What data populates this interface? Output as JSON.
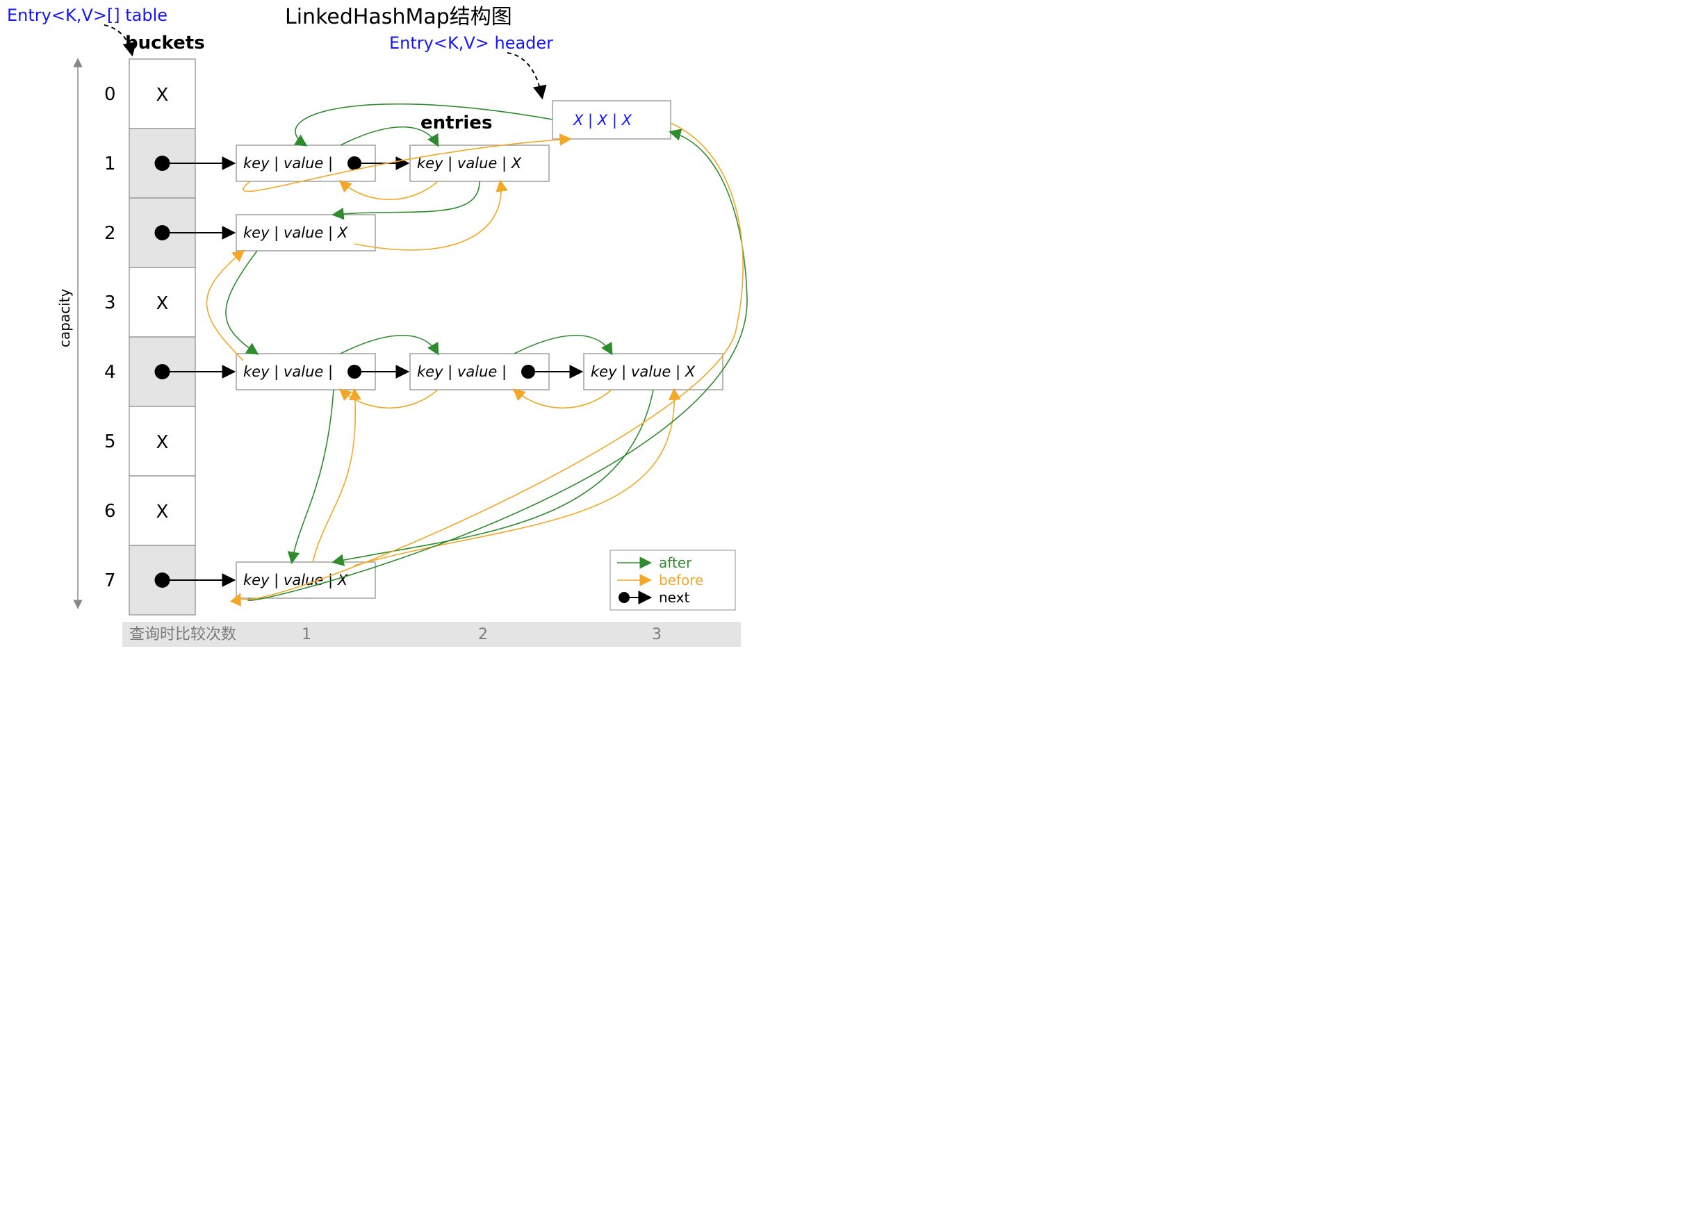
{
  "title": "LinkedHashMap结构图",
  "label_table": "Entry<K,V>[] table",
  "label_header": "Entry<K,V> header",
  "label_buckets": "buckets",
  "label_entries": "entries",
  "label_capacity": "capacity",
  "buckets": {
    "indices": [
      "0",
      "1",
      "2",
      "3",
      "4",
      "5",
      "6",
      "7"
    ],
    "cells": [
      "X",
      "●",
      "●",
      "X",
      "●",
      "X",
      "X",
      "●"
    ],
    "filled": [
      false,
      true,
      true,
      false,
      true,
      false,
      false,
      true
    ]
  },
  "entry_text": "key | value | ",
  "entry_text_end": "key | value |  X",
  "header_text": "X  |  X  |  X",
  "legend": {
    "after": "after",
    "before": "before",
    "next": "next"
  },
  "footer": {
    "label": "查询时比较次数",
    "cols": [
      "1",
      "2",
      "3"
    ]
  }
}
